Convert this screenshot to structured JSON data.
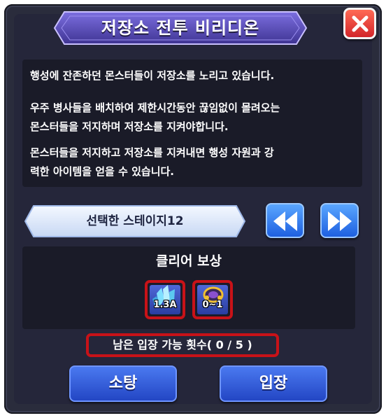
{
  "window": {
    "title": "저장소 전투   비리디온"
  },
  "description": {
    "line1": "행성에 잔존하던 몬스터들이 저장소를 노리고 있습니다.",
    "line2": "우주 병사들을 배치하여 제한시간동안 끊임없이 몰려오는",
    "line3": "몬스터들을 저지하며 저장소를 지켜야합니다.",
    "line4": "몬스터들을 저지하고 저장소를 지켜내면 행성 자원과 강",
    "line5": "력한 아이템을 얻을 수 있습니다."
  },
  "stage": {
    "label": "선택한 스테이지12",
    "prev_icon": "double-left-arrow-icon",
    "next_icon": "double-right-arrow-icon"
  },
  "rewards": {
    "title": "클리어 보상",
    "items": [
      {
        "icon": "blue-crystal-icon",
        "quantity": "1.3A"
      },
      {
        "icon": "alien-helmet-icon",
        "quantity": "0~1"
      }
    ]
  },
  "entry": {
    "text": "남은 입장 가능 횟수( 0 / 5 )"
  },
  "buttons": {
    "sweep": "소탕",
    "enter": "입장"
  },
  "colors": {
    "panel": "#25263a",
    "highlight": "#c81218",
    "button_blue": "#2f56d8",
    "close_red": "#e5383b"
  }
}
